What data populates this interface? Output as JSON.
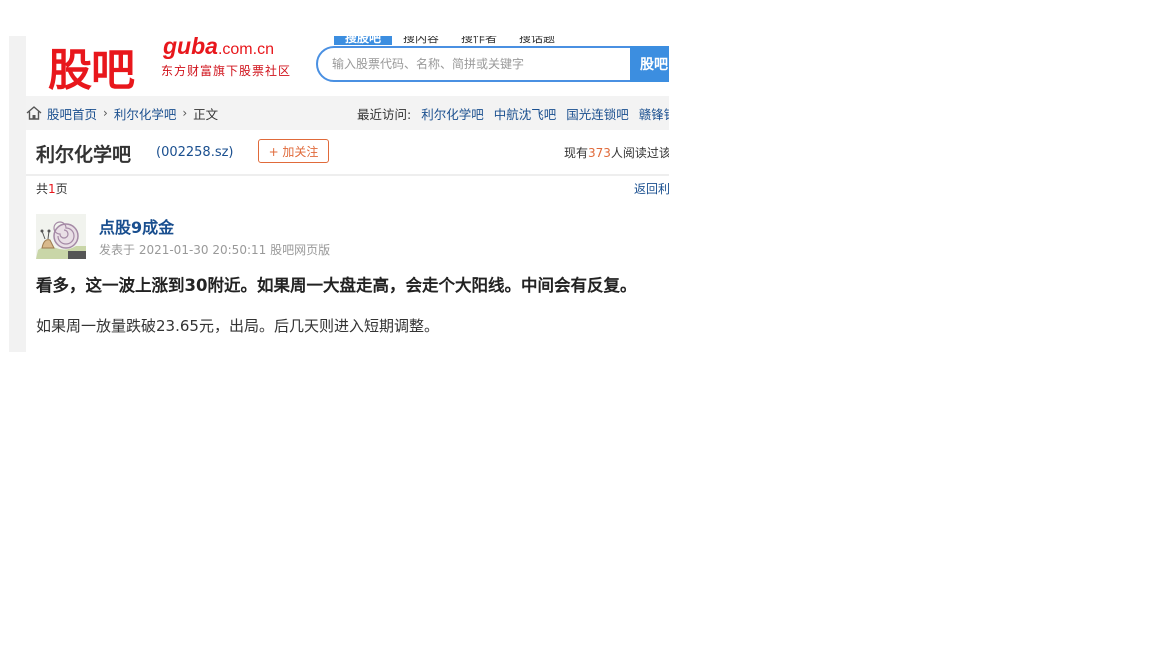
{
  "header": {
    "logo_cn": "股吧",
    "logo_domain": "guba",
    "logo_domain_suffix": ".com.cn",
    "logo_tagline": "东方财富旗下股票社区",
    "search_tabs": [
      "搜股吧",
      "搜内容",
      "搜作者",
      "搜话题"
    ],
    "search_placeholder": "输入股票代码、名称、简拼或关键字",
    "search_button": "股吧"
  },
  "breadcrumb": {
    "home": "股吧首页",
    "bar": "利尔化学吧",
    "current": "正文"
  },
  "recent": {
    "label": "最近访问:",
    "items": [
      "利尔化学吧",
      "中航沈飞吧",
      "国光连锁吧",
      "赣锋锂"
    ]
  },
  "bar_info": {
    "name": "利尔化学吧",
    "code": "(002258.sz)",
    "follow_button": "+ 加关注",
    "readers_prefix": "现有",
    "readers_count": "373",
    "readers_suffix": "人阅读过该"
  },
  "pager": {
    "prefix": "共",
    "count": "1",
    "suffix": "页",
    "return_link": "返回利"
  },
  "post": {
    "author": "点股9成金",
    "meta": "发表于 2021-01-30 20:50:11 股吧网页版",
    "title": "看多，这一波上涨到30附近。如果周一大盘走高，会走个大阳线。中间会有反复。",
    "body": "如果周一放量跌破23.65元，出局。后几天则进入短期调整。"
  },
  "colors": {
    "brand_red": "#e8171c",
    "link_blue": "#1a4f8f",
    "accent_orange": "#e06a3a",
    "search_blue": "#3c8ee0"
  }
}
